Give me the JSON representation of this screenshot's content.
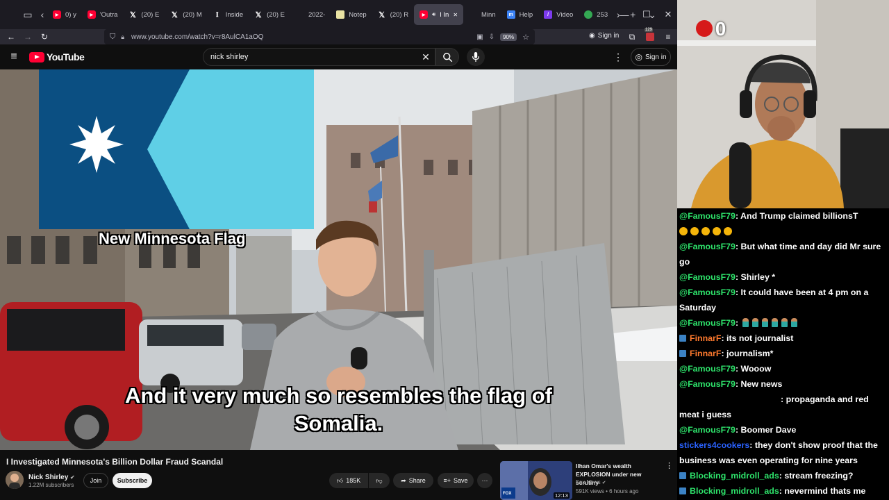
{
  "browser": {
    "tabs": [
      {
        "label": "0) y",
        "icon": "youtube-icon",
        "kind": "yt"
      },
      {
        "label": "'Outra",
        "icon": "youtube-icon",
        "kind": "yt"
      },
      {
        "label": "(20) E",
        "icon": "x-icon",
        "kind": "x"
      },
      {
        "label": "(20) M",
        "icon": "x-icon",
        "kind": "x"
      },
      {
        "label": "Inside",
        "icon": "insider-icon",
        "kind": "ins"
      },
      {
        "label": "(20) E",
        "icon": "x-icon",
        "kind": "x"
      },
      {
        "label": "2022-",
        "icon": "blank-icon",
        "kind": "none"
      },
      {
        "label": "Notep",
        "icon": "notepad-icon",
        "kind": "note"
      },
      {
        "label": "(20) R",
        "icon": "x-icon",
        "kind": "x"
      },
      {
        "label": "I In",
        "icon": "youtube-icon",
        "kind": "yt",
        "active": true
      },
      {
        "label": "Minn",
        "icon": "blank-icon",
        "kind": "none"
      },
      {
        "label": "Help",
        "icon": "microsoft-icon",
        "kind": "ms"
      },
      {
        "label": "Video",
        "icon": "video-icon",
        "kind": "vid"
      },
      {
        "label": "253",
        "icon": "maps-icon",
        "kind": "map"
      }
    ],
    "url": "www.youtube.com/watch?v=r8AulCA1aOQ",
    "zoom": "90%",
    "signin": "Sign in",
    "ext_badge": "129"
  },
  "youtube": {
    "logo_text": "YouTube",
    "search_query": "nick shirley",
    "signin": "Sign in"
  },
  "video": {
    "flag_caption": "New Minnesota Flag",
    "subtitle_line1": "And it very much so resembles the flag of",
    "subtitle_line2": "Somalia.",
    "title": "I Investigated Minnesota's Billion Dollar Fraud Scandal",
    "channel": "Nick Shirley",
    "subscribers": "1.22M subscribers",
    "join": "Join",
    "subscribe": "Subscribe",
    "likes": "185K",
    "share": "Share",
    "save": "Save"
  },
  "recommended": {
    "title": "Ilhan Omar's wealth EXPLOSION under new scrutiny",
    "channel": "Fox News",
    "meta": "591K views • 6 hours ago",
    "duration": "12:13",
    "thumb_brand": "FOX NEWS"
  },
  "overlay": {
    "counter": "0"
  },
  "chat": [
    {
      "user": "@FamousF79",
      "color": "#2ee36b",
      "text": ": And Trump claimed billionsT",
      "emojis": 5,
      "badge": false
    },
    {
      "user": "@FamousF79",
      "color": "#2ee36b",
      "text": ": But what time and day did Mr sure go",
      "badge": false
    },
    {
      "user": "@FamousF79",
      "color": "#2ee36b",
      "text": ": Shirley *",
      "badge": false
    },
    {
      "user": "@FamousF79",
      "color": "#2ee36b",
      "text": ": It could have been at 4 pm on a Saturday",
      "badge": false
    },
    {
      "user": "@FamousF79",
      "color": "#2ee36b",
      "text": ":",
      "people": 6,
      "badge": false
    },
    {
      "user": "FinnarF",
      "color": "#ff7a2e",
      "text": ": its not journalist",
      "badge": true
    },
    {
      "user": "FinnarF",
      "color": "#ff7a2e",
      "text": ": journalism*",
      "badge": true
    },
    {
      "user": "@FamousF79",
      "color": "#2ee36b",
      "text": ": Wooow",
      "badge": false
    },
    {
      "user": "@FamousF79",
      "color": "#2ee36b",
      "text": ": New news",
      "badge": false
    },
    {
      "user": "",
      "color": "#000000",
      "text": ": propaganda and red meat i guess",
      "badge": false,
      "indent": true
    },
    {
      "user": "@FamousF79",
      "color": "#2ee36b",
      "text": ": Boomer Dave",
      "badge": false
    },
    {
      "user": "stickers4cookers",
      "color": "#2a62ff",
      "text": ": they don't show proof that the business was even operating for nine years",
      "badge": false
    },
    {
      "user": "Blocking_midroll_ads",
      "color": "#2ee36b",
      "text": ": stream freezing?",
      "badge": true
    },
    {
      "user": "Blocking_midroll_ads",
      "color": "#2ee36b",
      "text": ": nevermind thats me",
      "badge": true
    }
  ],
  "colors": {
    "yt_red": "#ff0033",
    "flag_dark": "#0b4f82",
    "flag_light": "#5fcfe6"
  }
}
